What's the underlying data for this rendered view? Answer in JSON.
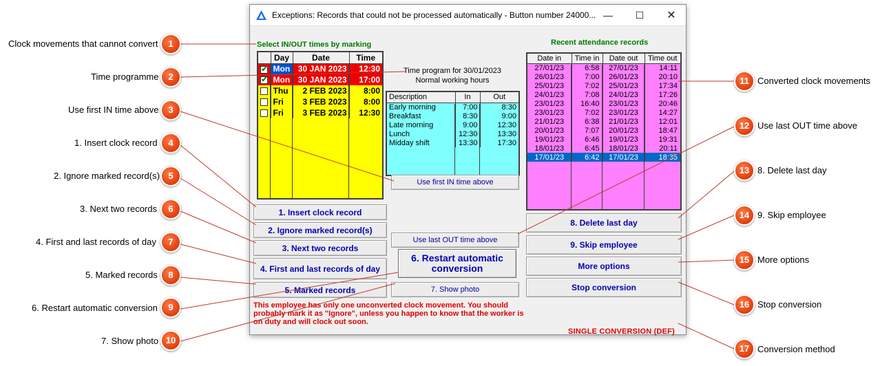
{
  "window": {
    "title": "Exceptions: Records that could not be processed automatically - Button number 24000...",
    "min_glyph": "—",
    "max_glyph": "☐",
    "close_glyph": "✕"
  },
  "left_group": {
    "title": "Select IN/OUT times by marking",
    "headers": [
      "",
      "Day",
      "Date",
      "Time"
    ],
    "rows": [
      {
        "checked": true,
        "day": "Mon",
        "date": "30 JAN 2023",
        "time": "12:30",
        "highlight": true
      },
      {
        "checked": true,
        "day": "Mon",
        "date": "30 JAN 2023",
        "time": "17:00",
        "highlight": true
      },
      {
        "checked": false,
        "day": "Thu",
        "date": "2 FEB 2023",
        "time": "8:00",
        "highlight": false
      },
      {
        "checked": false,
        "day": "Fri",
        "date": "3 FEB 2023",
        "time": "8:00",
        "highlight": false
      },
      {
        "checked": false,
        "day": "Fri",
        "date": "3 FEB 2023",
        "time": "12:30",
        "highlight": false
      }
    ]
  },
  "time_program": {
    "title_line1": "Time program for 30/01/2023",
    "title_line2": "Normal working hours",
    "headers": [
      "Description",
      "In",
      "Out"
    ],
    "rows": [
      {
        "desc": "Early morning",
        "in": "7:00",
        "out": "8:30"
      },
      {
        "desc": "Breakfast",
        "in": "8:30",
        "out": "9:00"
      },
      {
        "desc": "Late morning",
        "in": "9:00",
        "out": "12:30"
      },
      {
        "desc": "Lunch",
        "in": "12:30",
        "out": "13:30"
      },
      {
        "desc": "Midday shift",
        "in": "13:30",
        "out": "17:30"
      }
    ]
  },
  "recent": {
    "title": "Recent attendance records",
    "headers": [
      "Date in",
      "Time in",
      "Date out",
      "Time out"
    ],
    "rows": [
      {
        "date_in": "27/01/23",
        "time_in": "6:58",
        "date_out": "27/01/23",
        "time_out": "14:11",
        "selected": false
      },
      {
        "date_in": "26/01/23",
        "time_in": "7:00",
        "date_out": "26/01/23",
        "time_out": "20:10",
        "selected": false
      },
      {
        "date_in": "25/01/23",
        "time_in": "7:02",
        "date_out": "25/01/23",
        "time_out": "17:34",
        "selected": false
      },
      {
        "date_in": "24/01/23",
        "time_in": "7:08",
        "date_out": "24/01/23",
        "time_out": "17:26",
        "selected": false
      },
      {
        "date_in": "23/01/23",
        "time_in": "16:40",
        "date_out": "23/01/23",
        "time_out": "20:46",
        "selected": false
      },
      {
        "date_in": "23/01/23",
        "time_in": "7:02",
        "date_out": "23/01/23",
        "time_out": "14:27",
        "selected": false
      },
      {
        "date_in": "21/01/23",
        "time_in": "6:38",
        "date_out": "21/01/23",
        "time_out": "12:01",
        "selected": false
      },
      {
        "date_in": "20/01/23",
        "time_in": "7:07",
        "date_out": "20/01/23",
        "time_out": "18:47",
        "selected": false
      },
      {
        "date_in": "19/01/23",
        "time_in": "6:46",
        "date_out": "19/01/23",
        "time_out": "19:31",
        "selected": false
      },
      {
        "date_in": "18/01/23",
        "time_in": "6:45",
        "date_out": "18/01/23",
        "time_out": "20:11",
        "selected": false
      },
      {
        "date_in": "17/01/23",
        "time_in": "6:42",
        "date_out": "17/01/23",
        "time_out": "18:35",
        "selected": true
      }
    ]
  },
  "buttons": {
    "use_first_in": "Use first IN time above",
    "use_last_out": "Use last OUT time above",
    "insert_clock": "1. Insert clock record",
    "ignore_marked": "2. Ignore marked record(s)",
    "next_two": "3. Next two records",
    "first_last": "4. First and last records of day",
    "marked": "5. Marked records",
    "restart": "6. Restart automatic conversion",
    "show_photo": "7. Show photo",
    "delete_last_day": "8. Delete last day",
    "skip_employee": "9. Skip employee",
    "more_options": "More options",
    "stop_conversion": "Stop conversion"
  },
  "warning_text": "This employee has only one unconverted clock movement. You should probably mark it as \"Ignore\", unless you happen to know that the worker is on duty and will clock out soon.",
  "conversion_method": "SINGLE CONVERSION (DEF)",
  "annotations": [
    {
      "num": "1",
      "label": "Clock movements that cannot convert"
    },
    {
      "num": "2",
      "label": "Time programme"
    },
    {
      "num": "3",
      "label": "Use first IN time above"
    },
    {
      "num": "4",
      "label": "1. Insert clock record"
    },
    {
      "num": "5",
      "label": "2. Ignore marked record(s)"
    },
    {
      "num": "6",
      "label": "3. Next two records"
    },
    {
      "num": "7",
      "label": "4. First and last records of day"
    },
    {
      "num": "8",
      "label": "5. Marked records"
    },
    {
      "num": "9",
      "label": "6. Restart automatic conversion"
    },
    {
      "num": "10",
      "label": "7. Show photo"
    },
    {
      "num": "11",
      "label": "Converted clock movements"
    },
    {
      "num": "12",
      "label": "Use last OUT time above"
    },
    {
      "num": "13",
      "label": "8. Delete last day"
    },
    {
      "num": "14",
      "label": "9. Skip employee"
    },
    {
      "num": "15",
      "label": "More options"
    },
    {
      "num": "16",
      "label": "Stop conversion"
    },
    {
      "num": "17",
      "label": "Conversion method"
    }
  ],
  "colors": {
    "exceptions_grid": "#ffff00",
    "highlight_row": "#ee0000",
    "time_program_grid": "#80ffff",
    "recent_grid": "#ff80ff",
    "selected_row": "#0068c8",
    "group_title": "#007a00",
    "button_text": "#0000b0",
    "warning_text": "#dd0000",
    "badge": "#e8501a"
  }
}
